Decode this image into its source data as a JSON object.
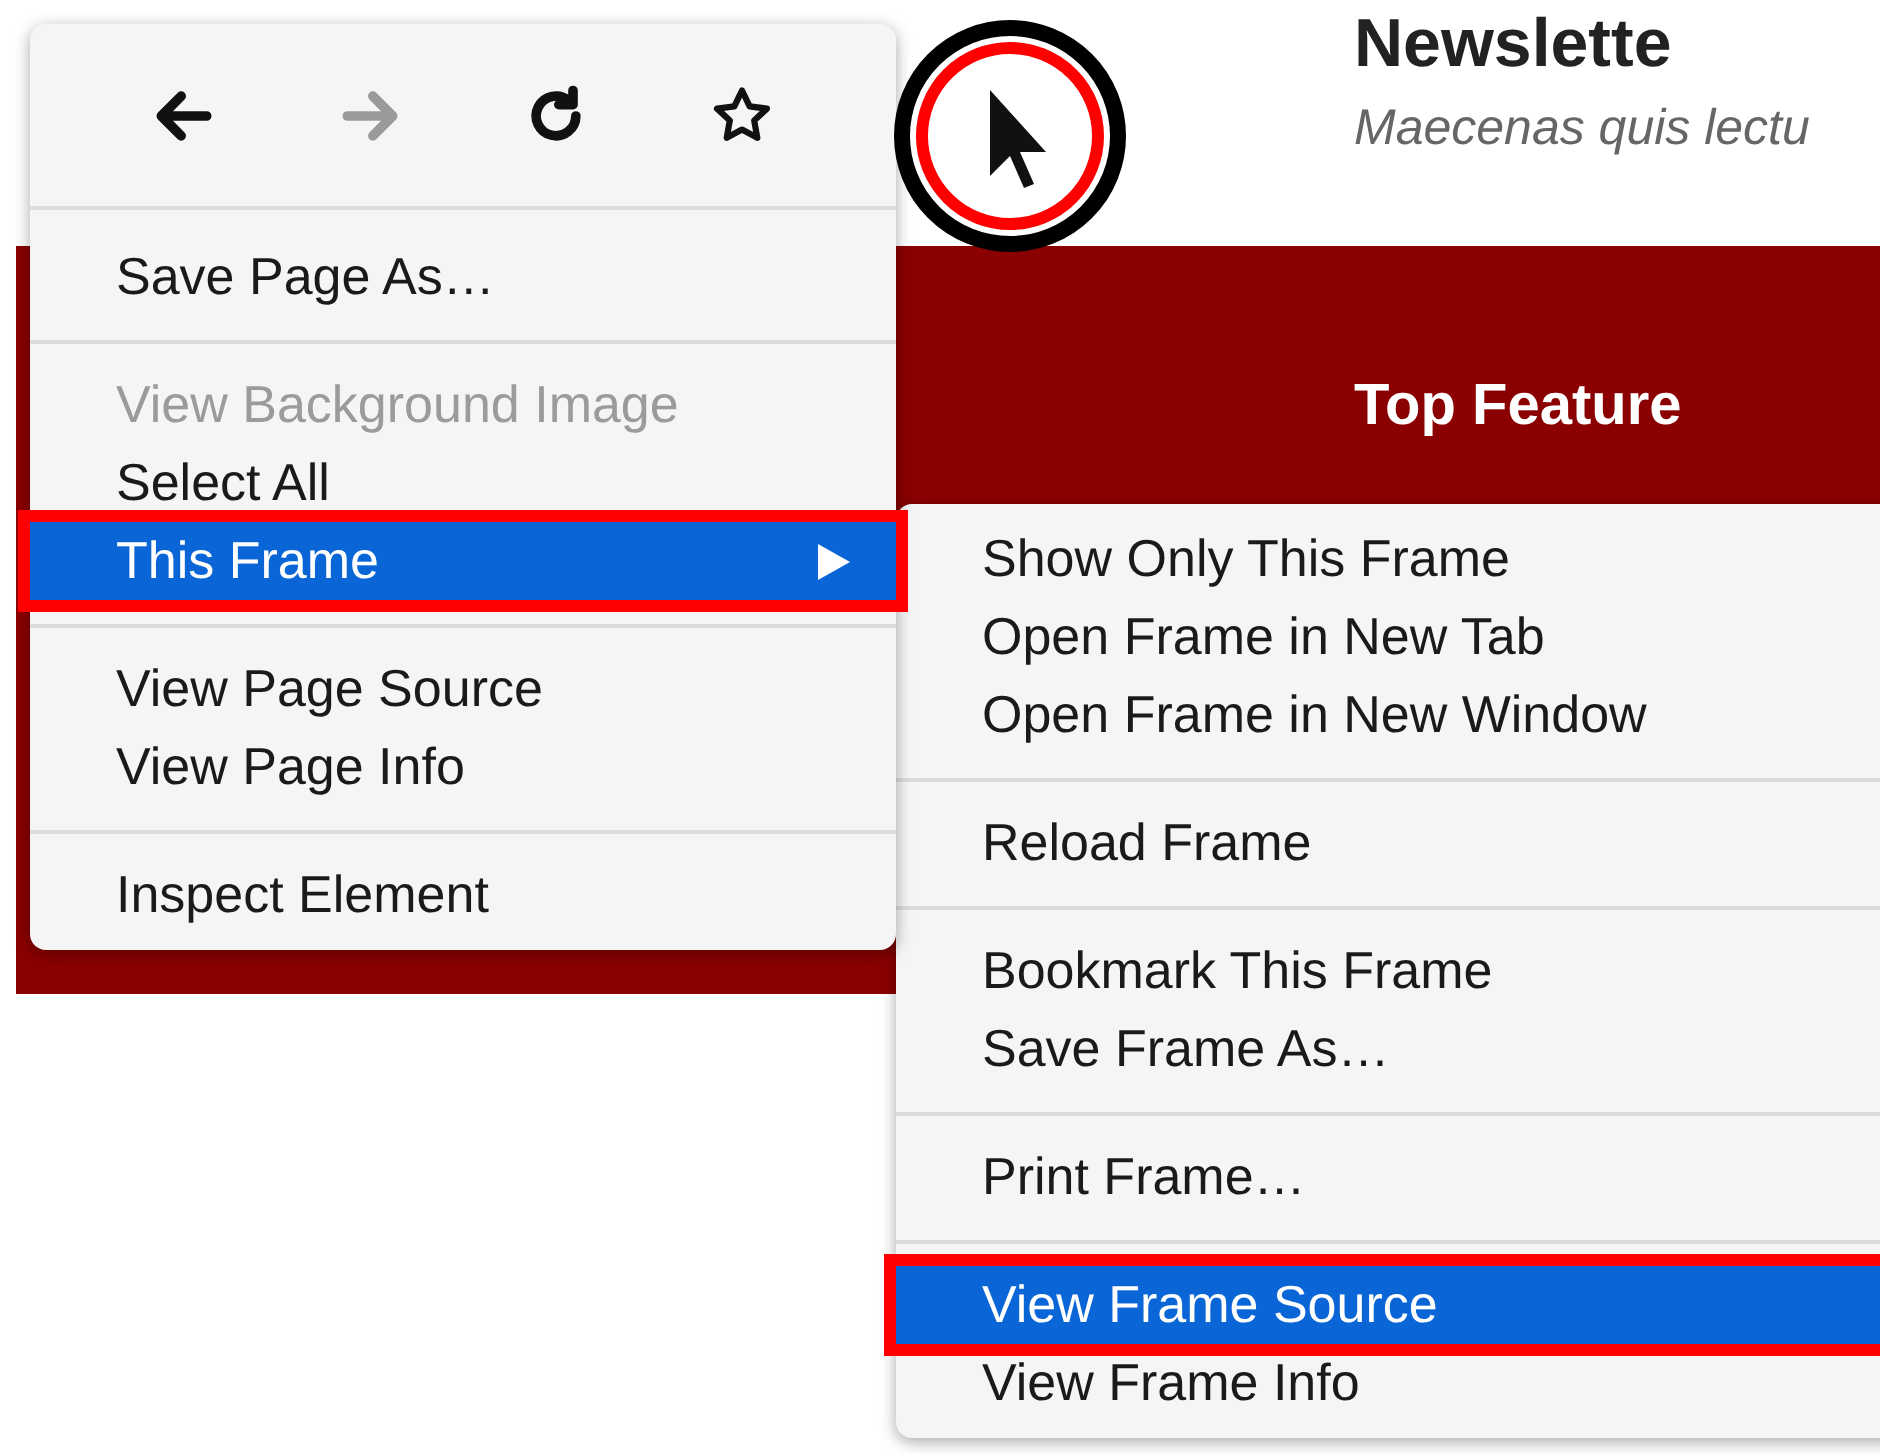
{
  "page": {
    "headline": "Newslette",
    "subtitle": "Maecenas quis lectu",
    "feature_title": "Top Feature"
  },
  "context_menu": {
    "toolbar": [
      {
        "kind": "back",
        "disabled": false
      },
      {
        "kind": "forward",
        "disabled": true
      },
      {
        "kind": "reload",
        "disabled": false
      },
      {
        "kind": "bookmark",
        "disabled": false
      }
    ],
    "groups": [
      [
        {
          "label": "Save Page As…",
          "disabled": false,
          "selected": false,
          "outlined": false,
          "has_submenu": false
        }
      ],
      [
        {
          "label": "View Background Image",
          "disabled": true,
          "selected": false,
          "outlined": false,
          "has_submenu": false
        },
        {
          "label": "Select All",
          "disabled": false,
          "selected": false,
          "outlined": false,
          "has_submenu": false
        },
        {
          "label": "This Frame",
          "disabled": false,
          "selected": true,
          "outlined": true,
          "has_submenu": true
        }
      ],
      [
        {
          "label": "View Page Source",
          "disabled": false,
          "selected": false,
          "outlined": false,
          "has_submenu": false
        },
        {
          "label": "View Page Info",
          "disabled": false,
          "selected": false,
          "outlined": false,
          "has_submenu": false
        }
      ],
      [
        {
          "label": "Inspect Element",
          "disabled": false,
          "selected": false,
          "outlined": false,
          "has_submenu": false
        }
      ]
    ]
  },
  "submenu": {
    "groups": [
      [
        {
          "label": "Show Only This Frame",
          "disabled": false,
          "selected": false,
          "outlined": false
        },
        {
          "label": "Open Frame in New Tab",
          "disabled": false,
          "selected": false,
          "outlined": false
        },
        {
          "label": "Open Frame in New Window",
          "disabled": false,
          "selected": false,
          "outlined": false
        }
      ],
      [
        {
          "label": "Reload Frame",
          "disabled": false,
          "selected": false,
          "outlined": false
        }
      ],
      [
        {
          "label": "Bookmark This Frame",
          "disabled": false,
          "selected": false,
          "outlined": false
        },
        {
          "label": "Save Frame As…",
          "disabled": false,
          "selected": false,
          "outlined": false
        }
      ],
      [
        {
          "label": "Print Frame…",
          "disabled": false,
          "selected": false,
          "outlined": false
        }
      ],
      [
        {
          "label": "View Frame Source",
          "disabled": false,
          "selected": true,
          "outlined": true
        },
        {
          "label": "View Frame Info",
          "disabled": false,
          "selected": false,
          "outlined": false
        }
      ]
    ]
  }
}
